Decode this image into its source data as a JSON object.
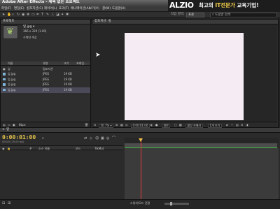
{
  "window": {
    "title": "Adobe After Effects - 제목 없는 프로젝트"
  },
  "menu": [
    "파일(F)",
    "편집(E)",
    "컴포지션(C)",
    "레이어(L)",
    "효과(T)",
    "애니메이션(A)",
    "보기(V)",
    "창(W)",
    "도움말(H)"
  ],
  "banner": {
    "logo": "ALZIO",
    "tagline_pre": "최고의 ",
    "tagline_hl": "IT전문가",
    "tagline_post": " 교육기업!"
  },
  "toolbar": {
    "workspace_label": "작업 영역:",
    "workspace_value": "표준",
    "search_placeholder": "도움말 검색"
  },
  "project": {
    "tab_label": "프로젝트",
    "preview_name": "잎.jpg ▾",
    "preview_dims": "366 x 329 (1.00)",
    "preview_color": "수백만 색상",
    "columns": {
      "name": "이름",
      "type": "유형",
      "size": "크기",
      "frame": "프레임..."
    },
    "rows": [
      {
        "name": "잎",
        "type": "컴포지션",
        "size": "",
        "selected": false
      },
      {
        "name": "잎.jpg",
        "type": "JPEG",
        "size": "19 KB",
        "selected": false
      },
      {
        "name": "잎.jpg",
        "type": "JPEG",
        "size": "19 KB",
        "selected": false
      },
      {
        "name": "잎.jpg",
        "type": "JPEG",
        "size": "19 KB",
        "selected": false
      },
      {
        "name": "잎.jpg",
        "type": "JPEG",
        "size": "19 KB",
        "selected": true
      }
    ],
    "bpc": "8bpc"
  },
  "composition": {
    "tab_label": "컴포지션: 잎",
    "zoom": "50.7% ▾",
    "timecode": "0:00:01:00",
    "quality": "절반",
    "view": "활성 카메라",
    "views_count": "1개 보기"
  },
  "timeline": {
    "tab_label": "잎",
    "current_time": "0:00:01:00",
    "fps_note": "00025 (25.00 fps)",
    "layer_columns": {
      "num": "#",
      "source": "소스 이름",
      "mode": "모드",
      "trkmat": "TrkMat"
    },
    "status": "스위치/모드 전환"
  },
  "colors": {
    "timecode": "#e6c44a",
    "playhead": "#e23b3b",
    "workarea": "#3fbf3f",
    "canvas": "#f4ecf2"
  }
}
